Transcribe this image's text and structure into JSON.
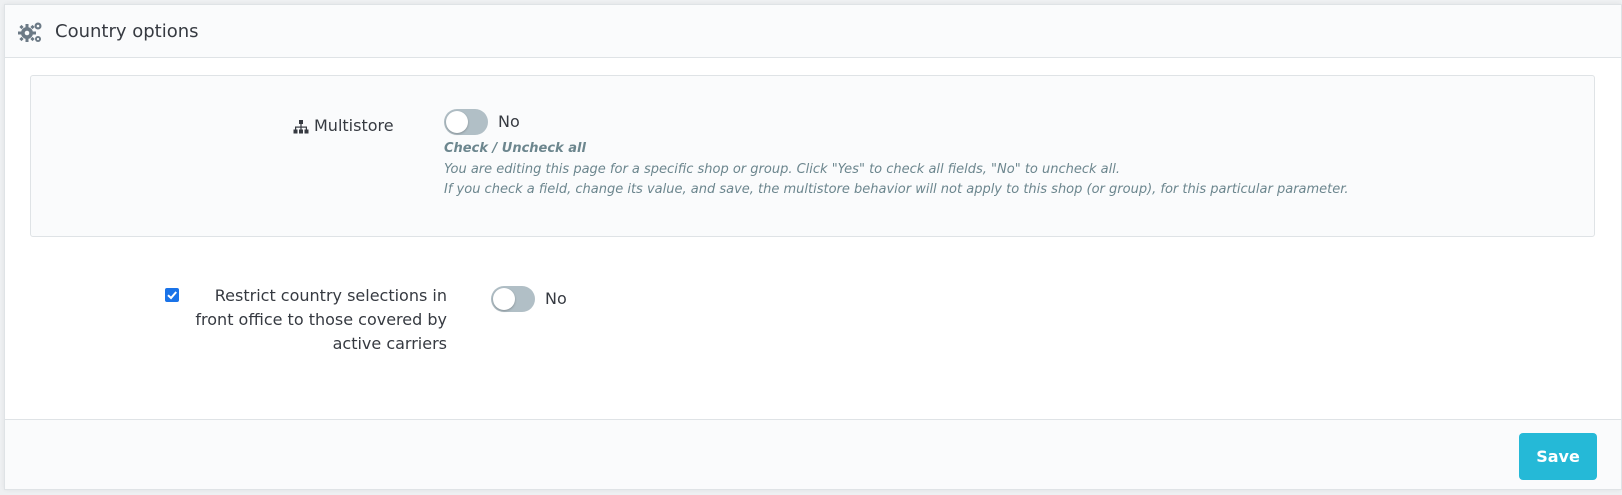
{
  "header": {
    "icon": "cogs-icon",
    "title": "Country options"
  },
  "multistore": {
    "icon": "sitemap-icon",
    "label": "Multistore",
    "toggle_value": "No",
    "toggle_on": false,
    "help_title": "Check / Uncheck all",
    "help_line1": "You are editing this page for a specific shop or group. Click \"Yes\" to check all fields, \"No\" to uncheck all.",
    "help_line2": "If you check a field, change its value, and save, the multistore behavior will not apply to this shop (or group), for this particular parameter."
  },
  "restrict": {
    "checked": true,
    "label": "Restrict country selections in front office to those covered by active carriers",
    "toggle_value": "No",
    "toggle_on": false
  },
  "footer": {
    "save_label": "Save"
  },
  "colors": {
    "accent": "#25b9d7",
    "toggle_off": "#b1bfc6",
    "checkbox": "#1a73e8",
    "help_text": "#6c868e"
  }
}
